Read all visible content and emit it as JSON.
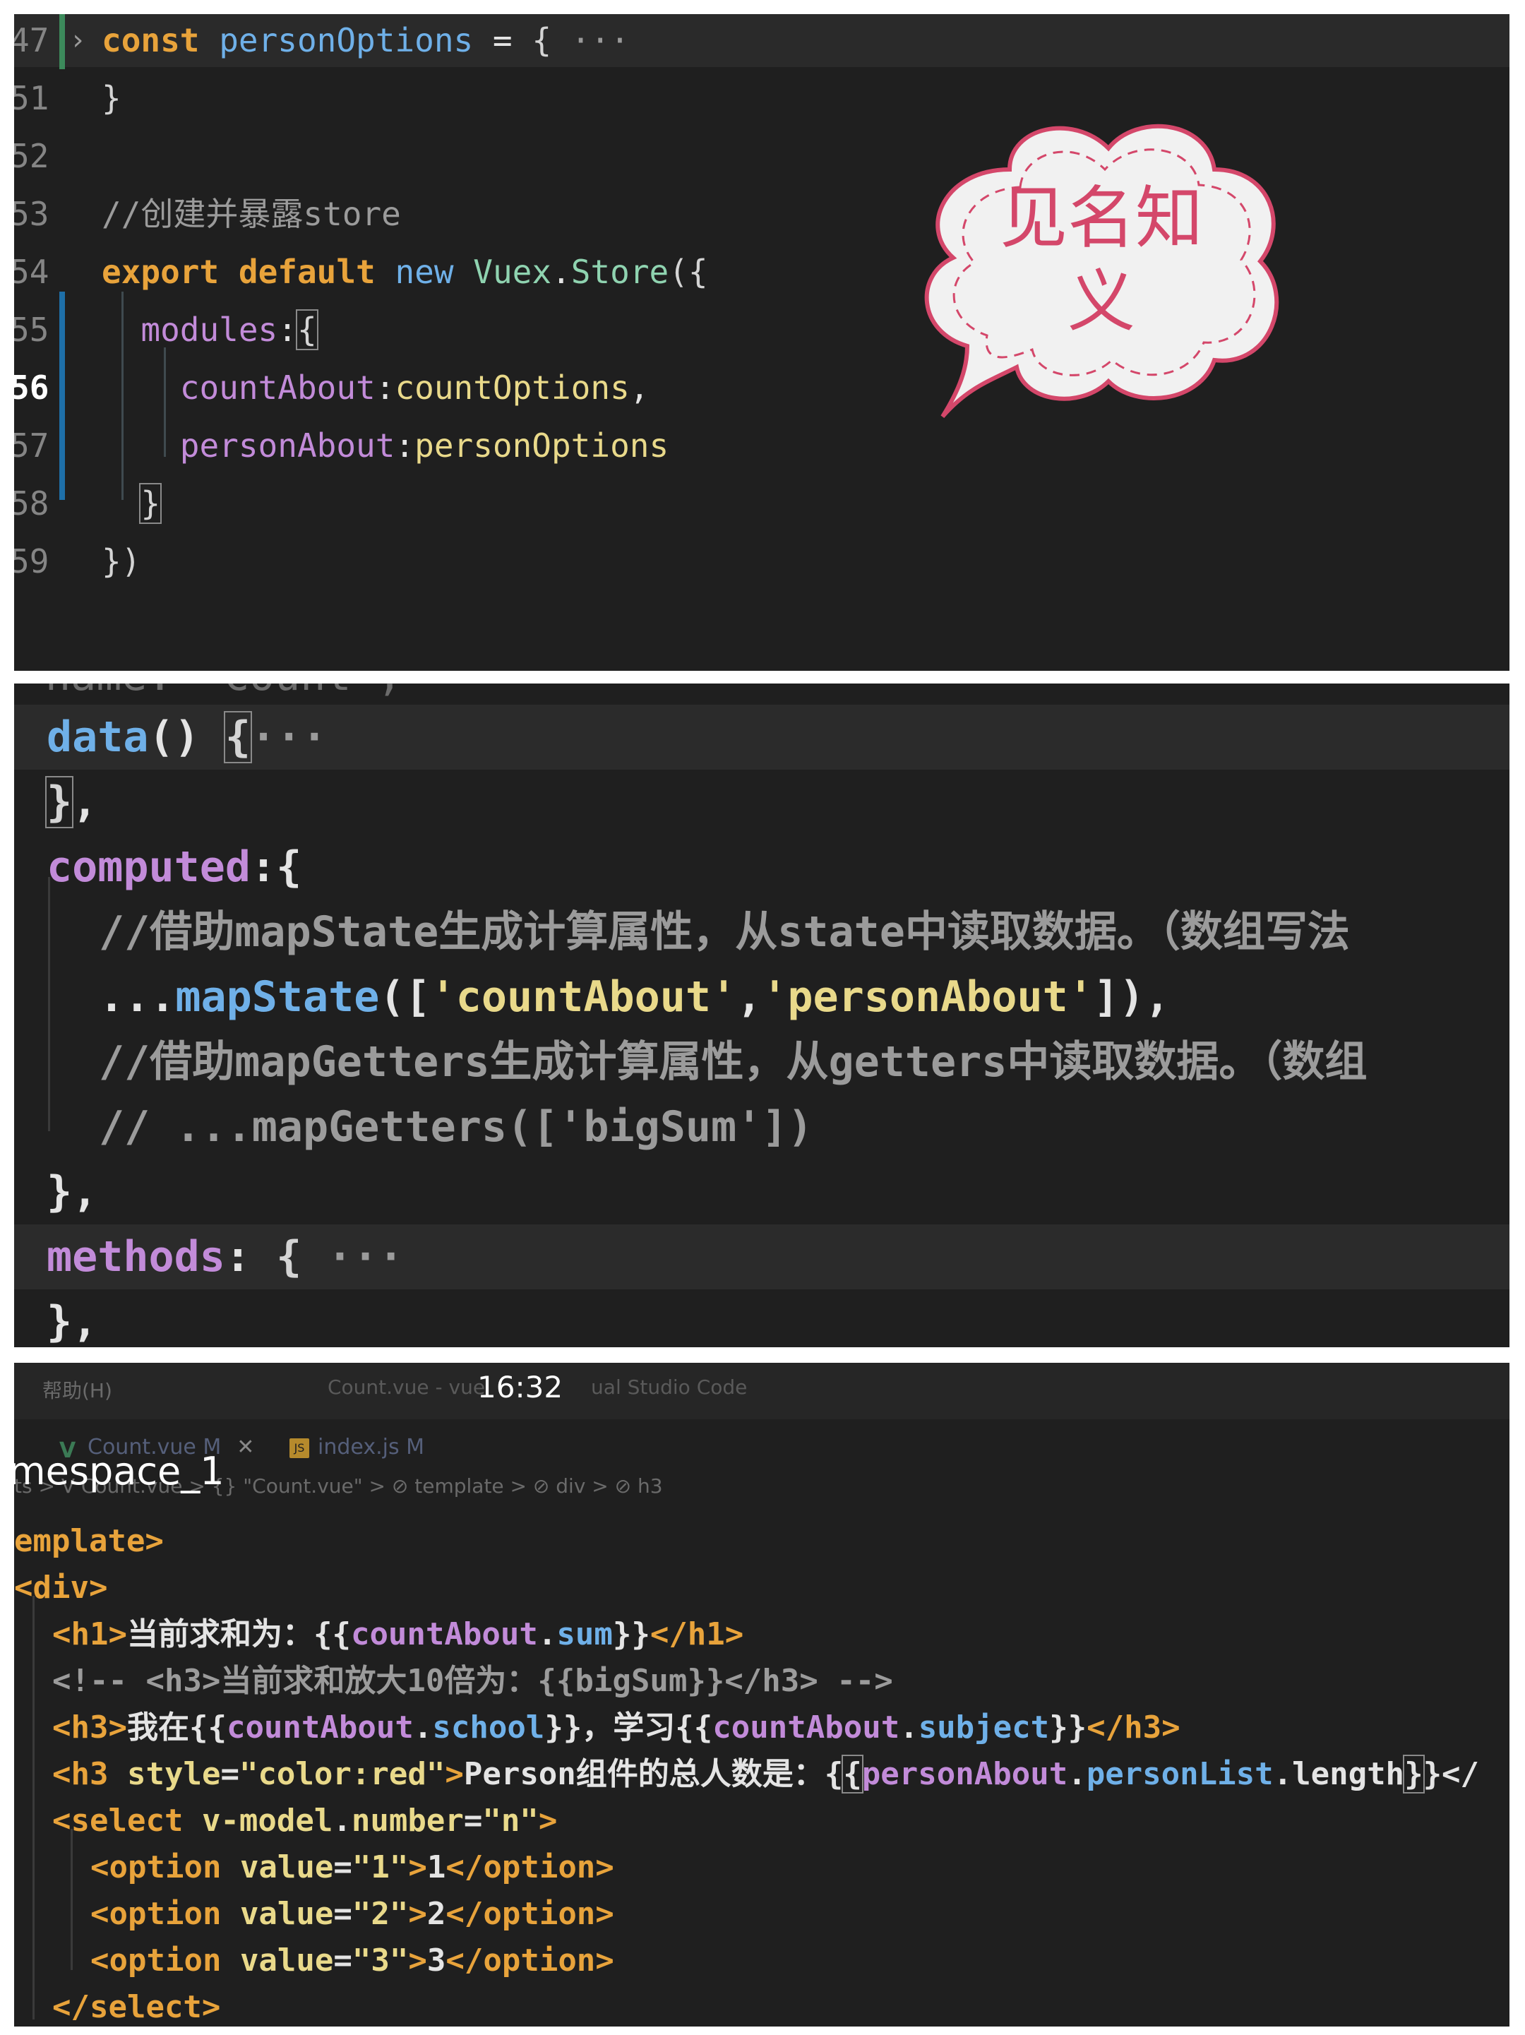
{
  "panel1": {
    "lines": [
      {
        "ln": "47",
        "text": [
          {
            "t": "const",
            "c": "c-kw"
          },
          {
            "t": " ",
            "c": "c-white"
          },
          {
            "t": "personOptions",
            "c": "c-blue"
          },
          {
            "t": " = ",
            "c": "c-white"
          },
          {
            "t": "{",
            "c": "c-brace"
          },
          {
            "t": " ···",
            "c": "c-gray"
          }
        ]
      },
      {
        "ln": "51",
        "text": [
          {
            "t": "}",
            "c": "c-brace"
          }
        ]
      },
      {
        "ln": "52",
        "text": []
      },
      {
        "ln": "53",
        "text": [
          {
            "t": "//创建并暴露store",
            "c": "c-gray"
          }
        ]
      },
      {
        "ln": "54",
        "text": [
          {
            "t": "export",
            "c": "c-kw"
          },
          {
            "t": " ",
            "c": "c-white"
          },
          {
            "t": "default",
            "c": "c-kw"
          },
          {
            "t": " ",
            "c": "c-white"
          },
          {
            "t": "new",
            "c": "c-blue"
          },
          {
            "t": " ",
            "c": "c-white"
          },
          {
            "t": "Vuex",
            "c": "c-green"
          },
          {
            "t": ".",
            "c": "c-white"
          },
          {
            "t": "Store",
            "c": "c-green"
          },
          {
            "t": "({",
            "c": "c-brace"
          }
        ]
      },
      {
        "ln": "55",
        "text": [
          {
            "t": "  modules",
            "c": "c-purple"
          },
          {
            "t": ":",
            "c": "c-white"
          },
          {
            "t": "{",
            "c": "c-brace bracket-box"
          }
        ]
      },
      {
        "ln": "56",
        "text": [
          {
            "t": "    countAbout",
            "c": "c-purple"
          },
          {
            "t": ":",
            "c": "c-white"
          },
          {
            "t": "countOptions",
            "c": "c-yellow"
          },
          {
            "t": ",",
            "c": "c-white"
          }
        ]
      },
      {
        "ln": "57",
        "text": [
          {
            "t": "    personAbout",
            "c": "c-purple"
          },
          {
            "t": ":",
            "c": "c-white"
          },
          {
            "t": "personOptions",
            "c": "c-yellow"
          }
        ]
      },
      {
        "ln": "58",
        "text": [
          {
            "t": "  ",
            "c": "c-white"
          },
          {
            "t": "}",
            "c": "c-brace bracket-box"
          }
        ]
      },
      {
        "ln": "59",
        "text": [
          {
            "t": "})",
            "c": "c-brace"
          }
        ]
      }
    ],
    "bubble_text": "见名知义"
  },
  "panel2": {
    "top_cut": "name: 'Count',",
    "lines": [
      {
        "indent": 0,
        "text": [
          {
            "t": "data",
            "c": "c-blue"
          },
          {
            "t": "() ",
            "c": "c-white"
          },
          {
            "t": "{",
            "c": "c-brace bracket-box"
          },
          {
            "t": "···",
            "c": "c-gray"
          }
        ],
        "hl": true
      },
      {
        "indent": 0,
        "text": [
          {
            "t": "}",
            "c": "c-brace bracket-box"
          },
          {
            "t": ",",
            "c": "c-white"
          }
        ]
      },
      {
        "indent": 0,
        "text": [
          {
            "t": "computed",
            "c": "c-purple"
          },
          {
            "t": ":{",
            "c": "c-white"
          }
        ]
      },
      {
        "indent": 1,
        "text": [
          {
            "t": "//借助mapState生成计算属性，从state中读取数据。（数组写法",
            "c": "c-gray"
          }
        ]
      },
      {
        "indent": 1,
        "text": [
          {
            "t": "...",
            "c": "c-white"
          },
          {
            "t": "mapState",
            "c": "c-blue"
          },
          {
            "t": "([",
            "c": "c-white"
          },
          {
            "t": "'countAbout'",
            "c": "c-string"
          },
          {
            "t": ",",
            "c": "c-white"
          },
          {
            "t": "'personAbout'",
            "c": "c-string"
          },
          {
            "t": "]),",
            "c": "c-white"
          }
        ]
      },
      {
        "indent": 1,
        "text": [
          {
            "t": "//借助mapGetters生成计算属性，从getters中读取数据。（数组",
            "c": "c-gray"
          }
        ]
      },
      {
        "indent": 1,
        "text": [
          {
            "t": "// ...mapGetters(['bigSum'])",
            "c": "c-gray"
          }
        ]
      },
      {
        "indent": 0,
        "text": [
          {
            "t": "},",
            "c": "c-white"
          }
        ]
      },
      {
        "indent": 0,
        "text": [
          {
            "t": "methods",
            "c": "c-purple"
          },
          {
            "t": ": ",
            "c": "c-white"
          },
          {
            "t": "{",
            "c": "c-brace"
          },
          {
            "t": " ···",
            "c": "c-gray"
          }
        ],
        "hl": true
      },
      {
        "indent": 0,
        "text": [
          {
            "t": "},",
            "c": "c-white"
          }
        ]
      }
    ]
  },
  "panel3": {
    "menu": "帮助(H)",
    "window_title": "Count.vue - vue",
    "window_title_tail": "ual Studio Code",
    "clock": "16:32",
    "tabs": [
      {
        "icon": "V",
        "label": "Count.vue",
        "badge": "M",
        "close": "✕"
      },
      {
        "icon": "JS",
        "label": "index.js",
        "badge": "M"
      }
    ],
    "overlay": "mespace_1",
    "breadcrumb": "ts > V Count.vue > {} \"Count.vue\" > ⊘ template > ⊘ div > ⊘ h3",
    "lines": [
      {
        "indent": 0,
        "text": [
          {
            "t": "emplate>",
            "c": "c-tag"
          }
        ]
      },
      {
        "indent": 0,
        "text": [
          {
            "t": "<div>",
            "c": "c-tag"
          }
        ]
      },
      {
        "indent": 1,
        "text": [
          {
            "t": "<h1>",
            "c": "c-tag"
          },
          {
            "t": "当前求和为：",
            "c": "c-white"
          },
          {
            "t": "{{",
            "c": "c-white"
          },
          {
            "t": "countAbout",
            "c": "c-purple"
          },
          {
            "t": ".",
            "c": "c-white"
          },
          {
            "t": "sum",
            "c": "c-prop"
          },
          {
            "t": "}}",
            "c": "c-white"
          },
          {
            "t": "</h1>",
            "c": "c-tag"
          }
        ]
      },
      {
        "indent": 1,
        "text": [
          {
            "t": "<!-- <h3>当前求和放大10倍为：{{bigSum}}</h3> -->",
            "c": "c-gray"
          }
        ]
      },
      {
        "indent": 1,
        "text": [
          {
            "t": "<h3>",
            "c": "c-tag"
          },
          {
            "t": "我在",
            "c": "c-white"
          },
          {
            "t": "{{",
            "c": "c-white"
          },
          {
            "t": "countAbout",
            "c": "c-purple"
          },
          {
            "t": ".",
            "c": "c-white"
          },
          {
            "t": "school",
            "c": "c-prop"
          },
          {
            "t": "}}",
            "c": "c-white"
          },
          {
            "t": "，学习",
            "c": "c-white"
          },
          {
            "t": "{{",
            "c": "c-white"
          },
          {
            "t": "countAbout",
            "c": "c-purple"
          },
          {
            "t": ".",
            "c": "c-white"
          },
          {
            "t": "subject",
            "c": "c-prop"
          },
          {
            "t": "}}",
            "c": "c-white"
          },
          {
            "t": "</h3>",
            "c": "c-tag"
          }
        ]
      },
      {
        "indent": 1,
        "text": [
          {
            "t": "<h3",
            "c": "c-tag"
          },
          {
            "t": " ",
            "c": "c-white"
          },
          {
            "t": "style",
            "c": "c-attr"
          },
          {
            "t": "=",
            "c": "c-white"
          },
          {
            "t": "\"color:red\"",
            "c": "c-string"
          },
          {
            "t": ">",
            "c": "c-tag"
          },
          {
            "t": "Person组件的总人数是：",
            "c": "c-white"
          },
          {
            "t": "{",
            "c": "c-white"
          },
          {
            "t": "{",
            "c": "c-white bracket-box"
          },
          {
            "t": "personAbout",
            "c": "c-purple"
          },
          {
            "t": ".",
            "c": "c-white"
          },
          {
            "t": "personList",
            "c": "c-prop"
          },
          {
            "t": ".",
            "c": "c-white"
          },
          {
            "t": "length",
            "c": "c-white"
          },
          {
            "t": "}",
            "c": "c-white bracket-box"
          },
          {
            "t": "}</",
            "c": "c-white"
          }
        ]
      },
      {
        "indent": 1,
        "text": [
          {
            "t": "<select",
            "c": "c-tag"
          },
          {
            "t": " ",
            "c": "c-white"
          },
          {
            "t": "v-model",
            "c": "c-attr"
          },
          {
            "t": ".",
            "c": "c-white"
          },
          {
            "t": "number",
            "c": "c-attr"
          },
          {
            "t": "=",
            "c": "c-white"
          },
          {
            "t": "\"n\"",
            "c": "c-string"
          },
          {
            "t": ">",
            "c": "c-tag"
          }
        ]
      },
      {
        "indent": 2,
        "text": [
          {
            "t": "<option",
            "c": "c-tag"
          },
          {
            "t": " ",
            "c": "c-white"
          },
          {
            "t": "value",
            "c": "c-attr"
          },
          {
            "t": "=",
            "c": "c-white"
          },
          {
            "t": "\"1\"",
            "c": "c-string"
          },
          {
            "t": ">",
            "c": "c-tag"
          },
          {
            "t": "1",
            "c": "c-white"
          },
          {
            "t": "</option>",
            "c": "c-tag"
          }
        ]
      },
      {
        "indent": 2,
        "text": [
          {
            "t": "<option",
            "c": "c-tag"
          },
          {
            "t": " ",
            "c": "c-white"
          },
          {
            "t": "value",
            "c": "c-attr"
          },
          {
            "t": "=",
            "c": "c-white"
          },
          {
            "t": "\"2\"",
            "c": "c-string"
          },
          {
            "t": ">",
            "c": "c-tag"
          },
          {
            "t": "2",
            "c": "c-white"
          },
          {
            "t": "</option>",
            "c": "c-tag"
          }
        ]
      },
      {
        "indent": 2,
        "text": [
          {
            "t": "<option",
            "c": "c-tag"
          },
          {
            "t": " ",
            "c": "c-white"
          },
          {
            "t": "value",
            "c": "c-attr"
          },
          {
            "t": "=",
            "c": "c-white"
          },
          {
            "t": "\"3\"",
            "c": "c-string"
          },
          {
            "t": ">",
            "c": "c-tag"
          },
          {
            "t": "3",
            "c": "c-white"
          },
          {
            "t": "</option>",
            "c": "c-tag"
          }
        ]
      },
      {
        "indent": 1,
        "text": [
          {
            "t": "</select>",
            "c": "c-tag"
          }
        ]
      }
    ]
  }
}
